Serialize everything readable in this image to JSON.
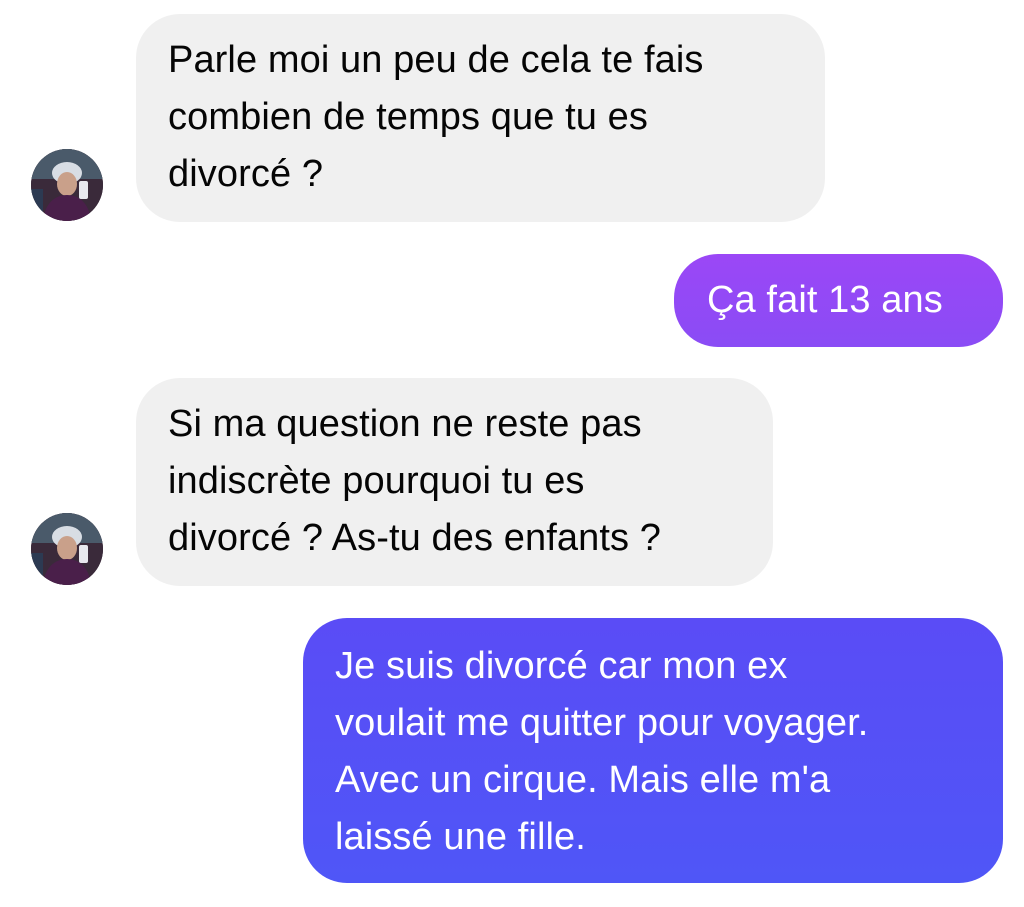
{
  "conversation": {
    "messages": [
      {
        "sender": "contact",
        "lines": [
          "Parle moi un peu de cela te fais",
          "combien de temps que tu es",
          "divorcé ?"
        ]
      },
      {
        "sender": "me",
        "lines": [
          "Ça fait 13 ans"
        ]
      },
      {
        "sender": "contact",
        "lines": [
          "Si ma question ne reste pas",
          "indiscrète pourquoi tu es",
          "divorcé ? As-tu des enfants ?"
        ]
      },
      {
        "sender": "me",
        "lines": [
          "Je suis divorcé car mon ex",
          "voulait me quitter pour voyager.",
          "Avec un cirque. Mais elle m'a",
          "laissé une fille."
        ]
      }
    ]
  },
  "colors": {
    "incoming_bubble": "#f0f0f0",
    "outgoing_bubble_purple": "#8f4af6",
    "outgoing_bubble_blue": "#5552f7",
    "text_dark": "#050505",
    "text_light": "#ffffff"
  },
  "icons": {
    "avatar": "contact-avatar-photo"
  }
}
